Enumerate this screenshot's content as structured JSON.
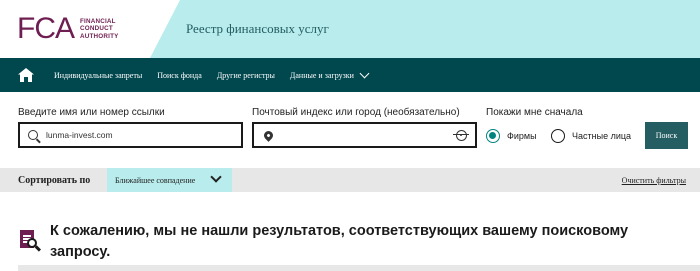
{
  "header": {
    "logo_mark": "FCA",
    "logo_text_lines": [
      "FINANCIAL",
      "CONDUCT",
      "AUTHORITY"
    ],
    "title": "Реестр финансовых услуг"
  },
  "nav": {
    "home_icon": "home-icon",
    "items": [
      {
        "label": "Индивидуальные запреты"
      },
      {
        "label": "Поиск фонда"
      },
      {
        "label": "Другие регистры"
      },
      {
        "label": "Данные и загрузки",
        "has_dropdown": true
      }
    ]
  },
  "search": {
    "name_label": "Введите имя или номер ссылки",
    "name_value": "lunma-invest.com",
    "location_label": "Почтовый индекс или город (необязательно)",
    "location_value": "",
    "show_first_label": "Покажи мне сначала",
    "options": [
      {
        "label": "Фирмы",
        "checked": true
      },
      {
        "label": "Частные лица",
        "checked": false
      }
    ],
    "search_button": "Поиск"
  },
  "sort": {
    "label": "Сортировать по",
    "selected": "Ближайшее совпадение",
    "clear_filters": "Очистить фильтры"
  },
  "results": {
    "message": "К сожалению, мы не нашли результатов, соответствующих вашему поисковому запросу."
  },
  "colors": {
    "brand_purple": "#6f1e51",
    "header_band": "#b9ecec",
    "nav_bg": "#00474e",
    "accent_teal": "#00847f",
    "button_bg": "#245d62",
    "sort_bar": "#e7e7e7"
  }
}
